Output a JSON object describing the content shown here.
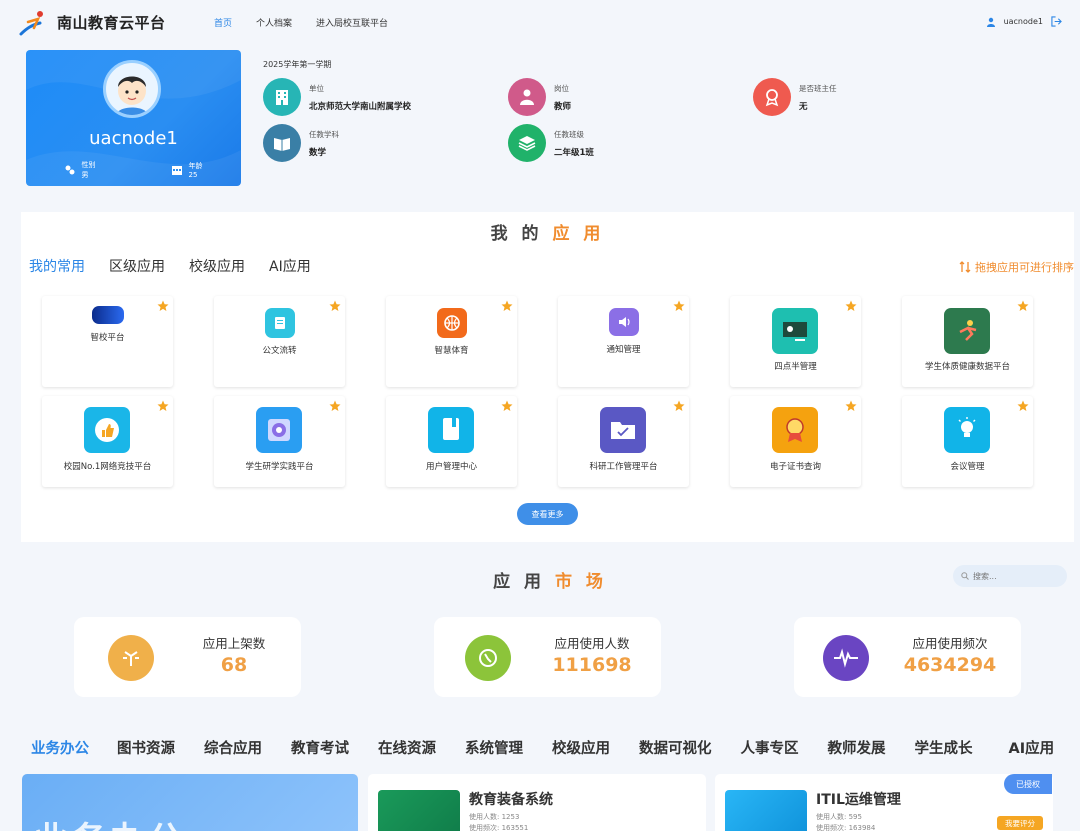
{
  "header": {
    "brand": "南山教育云平台",
    "nav": [
      "首页",
      "个人档案",
      "进入局校互联平台"
    ],
    "user": "uacnode1"
  },
  "profile": {
    "username": "uacnode1",
    "gender_label": "性别",
    "gender": "男",
    "age_label": "年龄",
    "age": "25"
  },
  "term": "2025学年第一学期",
  "info": {
    "unit_label": "单位",
    "unit": "北京师范大学南山附属学校",
    "post_label": "岗位",
    "post": "教师",
    "head_label": "是否班主任",
    "head": "无",
    "subject_label": "任教学科",
    "subject": "数学",
    "class_label": "任教班级",
    "class": "二年级1班"
  },
  "my_apps": {
    "title_a": "我 的",
    "title_b": "应 用",
    "tabs": [
      "我的常用",
      "区级应用",
      "校级应用",
      "AI应用"
    ],
    "drag_hint": "拖拽应用可进行排序",
    "apps": [
      "智校平台",
      "公文流转",
      "智慧体育",
      "通知管理",
      "四点半管理",
      "学生体质健康数据平台",
      "校园No.1网络竞技平台",
      "学生研学实践平台",
      "用户管理中心",
      "科研工作管理平台",
      "电子证书查询",
      "会议管理"
    ],
    "more": "查看更多"
  },
  "market": {
    "title_a": "应 用",
    "title_b": "市 场",
    "search_placeholder": "搜索...",
    "stats": [
      {
        "label": "应用上架数",
        "value": "68"
      },
      {
        "label": "应用使用人数",
        "value": "111698"
      },
      {
        "label": "应用使用频次",
        "value": "4634294"
      }
    ]
  },
  "categories": [
    "业务办公",
    "图书资源",
    "综合应用",
    "教育考试",
    "在线资源",
    "系统管理",
    "校级应用",
    "数据可视化",
    "人事专区",
    "教师发展",
    "学生成长",
    "AI应用"
  ],
  "bottom": {
    "biz_title": "业务办公",
    "systems": [
      {
        "name": "教育装备系统",
        "users": "使用人数: 1253",
        "freq": "使用频次: 163551"
      },
      {
        "name": "ITIL运维管理",
        "users": "使用人数: 595",
        "freq": "使用频次: 163984"
      }
    ],
    "auth_tag": "已授权",
    "rate": "我要评分"
  },
  "colors": {
    "primary": "#2b86e6",
    "accent": "#f08c2e",
    "stat_value": "#f0a045"
  }
}
